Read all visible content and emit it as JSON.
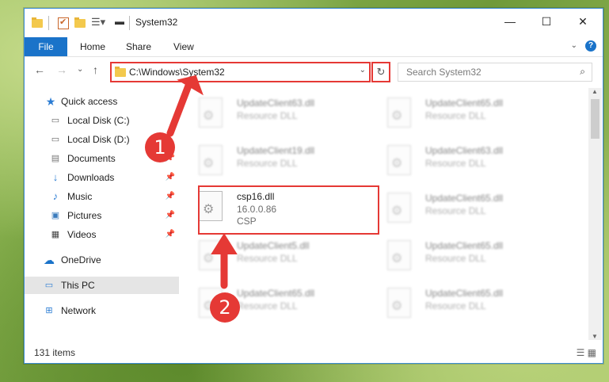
{
  "window": {
    "title": "System32"
  },
  "window_controls": {
    "minimize": "—",
    "maximize": "☐",
    "close": "✕"
  },
  "ribbon": {
    "file": "File",
    "tabs": [
      "Home",
      "Share",
      "View"
    ],
    "help": "?"
  },
  "address": {
    "path": "C:\\Windows\\System32",
    "dropdown": "⌄",
    "refresh": "↻"
  },
  "search": {
    "placeholder": "Search System32",
    "icon": "⌕"
  },
  "nav": {
    "back": "←",
    "forward": "→",
    "recent": "⌄",
    "up": "↑"
  },
  "sidebar": {
    "items": [
      {
        "label": "Quick access",
        "icon": "star-icon"
      },
      {
        "label": "Local Disk (C:)",
        "icon": "drive-icon"
      },
      {
        "label": "Local Disk (D:)",
        "icon": "drive-icon"
      },
      {
        "label": "Documents",
        "icon": "documents-icon"
      },
      {
        "label": "Downloads",
        "icon": "download-icon"
      },
      {
        "label": "Music",
        "icon": "music-icon"
      },
      {
        "label": "Pictures",
        "icon": "pictures-icon"
      },
      {
        "label": "Videos",
        "icon": "video-icon"
      },
      {
        "label": "OneDrive",
        "icon": "cloud-icon"
      },
      {
        "label": "This PC",
        "icon": "computer-icon"
      },
      {
        "label": "Network",
        "icon": "network-icon"
      }
    ]
  },
  "files": [
    {
      "name": "UpdateClient63.dll",
      "meta1": "Resource DLL",
      "meta2": ""
    },
    {
      "name": "UpdateClient65.dll",
      "meta1": "Resource DLL",
      "meta2": ""
    },
    {
      "name": "UpdateClient19.dll",
      "meta1": "Resource DLL",
      "meta2": ""
    },
    {
      "name": "UpdateClient63.dll",
      "meta1": "Resource DLL",
      "meta2": ""
    },
    {
      "name": "csp16.dll",
      "meta1": "16.0.0.86",
      "meta2": "CSP"
    },
    {
      "name": "UpdateClient65.dll",
      "meta1": "Resource DLL",
      "meta2": ""
    },
    {
      "name": "UpdateClient5.dll",
      "meta1": "Resource DLL",
      "meta2": ""
    },
    {
      "name": "UpdateClient65.dll",
      "meta1": "Resource DLL",
      "meta2": ""
    },
    {
      "name": "UpdateClient65.dll",
      "meta1": "Resource DLL",
      "meta2": ""
    },
    {
      "name": "UpdateClient65.dll",
      "meta1": "Resource DLL",
      "meta2": ""
    }
  ],
  "status": {
    "items": "131 items"
  },
  "markers": [
    "1",
    "2"
  ],
  "colors": {
    "accent": "#1a73c9",
    "annotation": "#e53935"
  }
}
